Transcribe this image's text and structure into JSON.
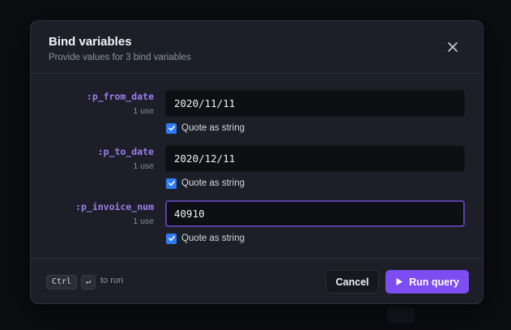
{
  "dialog": {
    "title": "Bind variables",
    "subtitle": "Provide values for 3 bind variables"
  },
  "variables": [
    {
      "name": ":p_from_date",
      "uses": "1 use",
      "value": "2020/11/11",
      "quote_label": "Quote as string",
      "quoted": true
    },
    {
      "name": ":p_to_date",
      "uses": "1 use",
      "value": "2020/12/11",
      "quote_label": "Quote as string",
      "quoted": true
    },
    {
      "name": ":p_invoice_num",
      "uses": "1 use",
      "value": "40910",
      "quote_label": "Quote as string",
      "quoted": true
    }
  ],
  "footer": {
    "shortcut_key1": "Ctrl",
    "shortcut_key2": "↵",
    "shortcut_hint": "to run",
    "cancel_label": "Cancel",
    "run_label": "Run query"
  },
  "icons": {
    "close": "close-icon",
    "check": "checkmark-icon",
    "play": "play-icon"
  },
  "colors": {
    "accent": "#7c4df0",
    "variable_name": "#a17cf0",
    "checkbox": "#2f7bf6"
  }
}
